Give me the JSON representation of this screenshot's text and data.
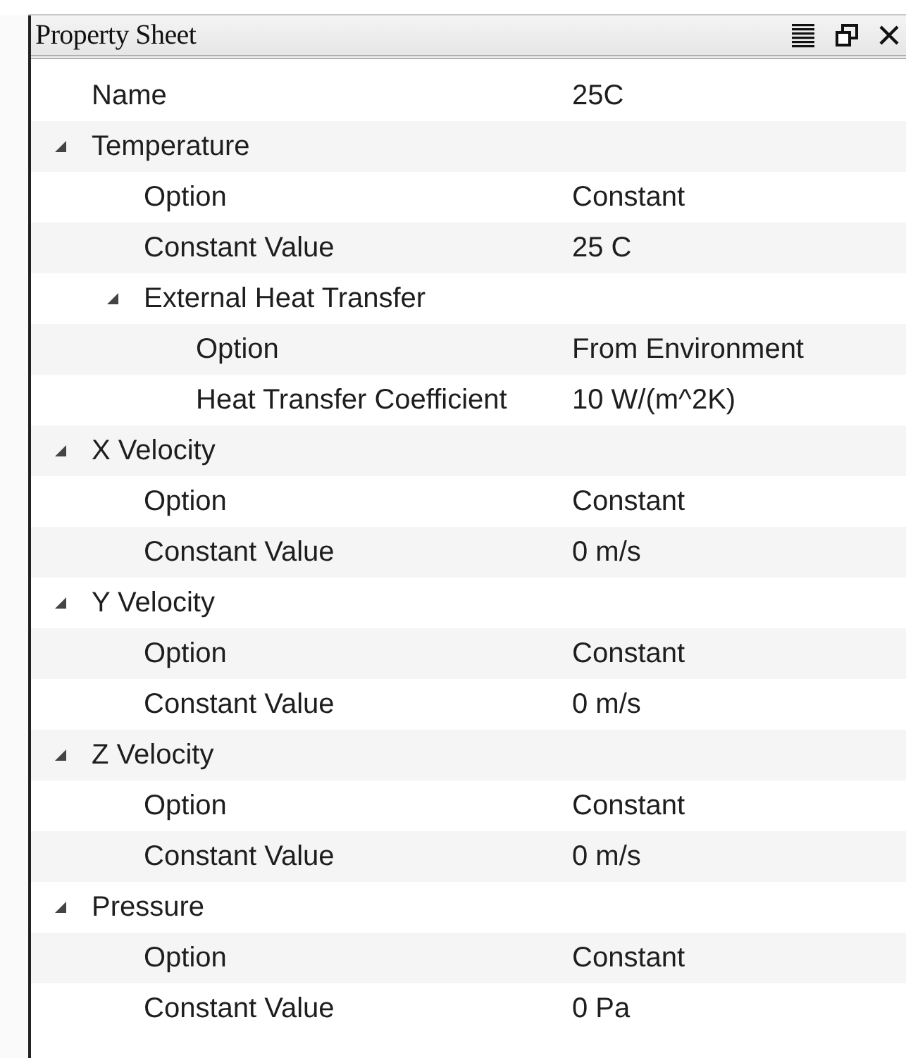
{
  "panel": {
    "title": "Property Sheet"
  },
  "properties": [
    {
      "name": "Name",
      "value": "25C"
    },
    {
      "name": "Temperature",
      "expanded": true,
      "children": [
        {
          "name": "Option",
          "value": "Constant"
        },
        {
          "name": "Constant Value",
          "value": "25 C"
        },
        {
          "name": "External Heat Transfer",
          "expanded": true,
          "children": [
            {
              "name": "Option",
              "value": "From Environment"
            },
            {
              "name": "Heat Transfer Coefficient",
              "value": "10 W/(m^2K)"
            }
          ]
        }
      ]
    },
    {
      "name": "X Velocity",
      "expanded": true,
      "children": [
        {
          "name": "Option",
          "value": "Constant"
        },
        {
          "name": "Constant Value",
          "value": "0 m/s"
        }
      ]
    },
    {
      "name": "Y Velocity",
      "expanded": true,
      "children": [
        {
          "name": "Option",
          "value": "Constant"
        },
        {
          "name": "Constant Value",
          "value": "0 m/s"
        }
      ]
    },
    {
      "name": "Z Velocity",
      "expanded": true,
      "children": [
        {
          "name": "Option",
          "value": "Constant"
        },
        {
          "name": "Constant Value",
          "value": "0 m/s"
        }
      ]
    },
    {
      "name": "Pressure",
      "expanded": true,
      "children": [
        {
          "name": "Option",
          "value": "Constant"
        },
        {
          "name": "Constant Value",
          "value": "0 Pa"
        }
      ]
    }
  ]
}
